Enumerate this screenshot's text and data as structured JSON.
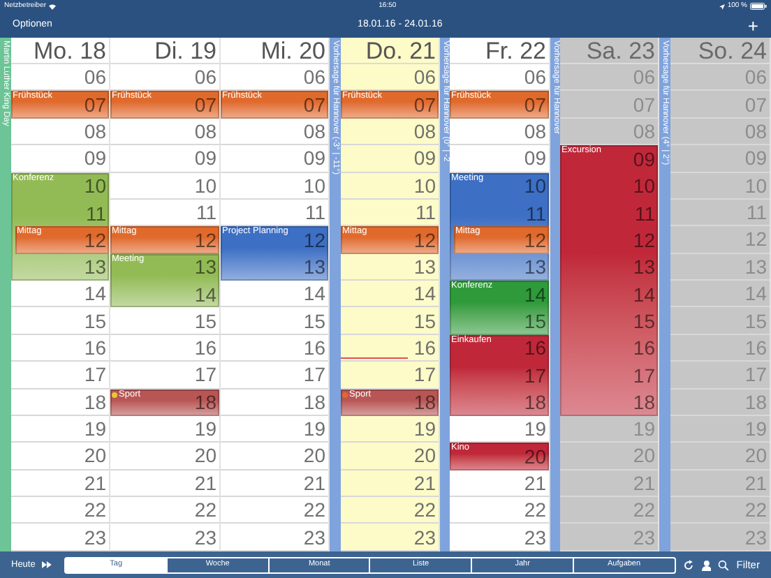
{
  "status_bar": {
    "carrier": "Netzbetreiber",
    "time": "16:50",
    "battery": "100 %"
  },
  "nav": {
    "left": "Optionen",
    "title": "18.01.16 - 24.01.16",
    "right": "+"
  },
  "columns": [
    {
      "kind": "strip",
      "label": "Martin Luther King Day",
      "color": "#6cc497"
    },
    {
      "kind": "day",
      "header": "Mo. 18",
      "today": false,
      "weekend": false,
      "rows": [
        {
          "kind": "hour",
          "label": "06"
        },
        {
          "kind": "event",
          "title": "Frühstück",
          "color": "#e06a2c",
          "rows": [
            {
              "kind": "hour",
              "label": "07"
            }
          ]
        },
        {
          "kind": "hour",
          "label": "08"
        },
        {
          "kind": "hour",
          "label": "09"
        },
        {
          "kind": "event",
          "title": "Konferenz",
          "color": "#93bb55",
          "rows": [
            {
              "kind": "hour",
              "label": "10"
            },
            {
              "kind": "hour",
              "label": "11"
            },
            {
              "kind": "event",
              "title": "Mittag",
              "color": "#e06a2c",
              "rows": [
                {
                  "kind": "hour",
                  "label": "12"
                }
              ]
            },
            {
              "kind": "hour",
              "label": "13"
            }
          ]
        },
        {
          "kind": "hour",
          "label": "14"
        },
        {
          "kind": "hour",
          "label": "15"
        },
        {
          "kind": "hour",
          "label": "16"
        },
        {
          "kind": "hour",
          "label": "17"
        },
        {
          "kind": "hour",
          "label": "18"
        },
        {
          "kind": "hour",
          "label": "19"
        },
        {
          "kind": "hour",
          "label": "20"
        },
        {
          "kind": "hour",
          "label": "21"
        },
        {
          "kind": "hour",
          "label": "22"
        },
        {
          "kind": "hour",
          "label": "23"
        }
      ]
    },
    {
      "kind": "day",
      "header": "Di. 19",
      "today": false,
      "weekend": false,
      "rows": [
        {
          "kind": "hour",
          "label": "06"
        },
        {
          "kind": "event",
          "title": "Frühstück",
          "color": "#e06a2c",
          "rows": [
            {
              "kind": "hour",
              "label": "07"
            }
          ]
        },
        {
          "kind": "hour",
          "label": "08"
        },
        {
          "kind": "hour",
          "label": "09"
        },
        {
          "kind": "hour",
          "label": "10"
        },
        {
          "kind": "hour",
          "label": "11"
        },
        {
          "kind": "event",
          "title": "Mittag",
          "color": "#e06a2c",
          "rows": [
            {
              "kind": "hour",
              "label": "12"
            }
          ]
        },
        {
          "kind": "event",
          "title": "Meeting",
          "color": "#93bb55",
          "rows": [
            {
              "kind": "hour",
              "label": "13"
            },
            {
              "kind": "hour",
              "label": "14"
            }
          ]
        },
        {
          "kind": "hour",
          "label": "15"
        },
        {
          "kind": "hour",
          "label": "16"
        },
        {
          "kind": "hour",
          "label": "17"
        },
        {
          "kind": "event",
          "title": "Sport",
          "color": "#b85555",
          "marker": {
            "color": "#e8c830"
          },
          "rows": [
            {
              "kind": "hour",
              "label": "18"
            }
          ]
        },
        {
          "kind": "hour",
          "label": "19"
        },
        {
          "kind": "hour",
          "label": "20"
        },
        {
          "kind": "hour",
          "label": "21"
        },
        {
          "kind": "hour",
          "label": "22"
        },
        {
          "kind": "hour",
          "label": "23"
        }
      ]
    },
    {
      "kind": "day",
      "header": "Mi. 20",
      "today": false,
      "weekend": false,
      "rows": [
        {
          "kind": "hour",
          "label": "06"
        },
        {
          "kind": "event",
          "title": "Frühstück",
          "color": "#e06a2c",
          "rows": [
            {
              "kind": "hour",
              "label": "07"
            }
          ]
        },
        {
          "kind": "hour",
          "label": "08"
        },
        {
          "kind": "hour",
          "label": "09"
        },
        {
          "kind": "hour",
          "label": "10"
        },
        {
          "kind": "hour",
          "label": "11"
        },
        {
          "kind": "event",
          "title": "Project Planning",
          "color": "#3d6fc4",
          "rows": [
            {
              "kind": "hour",
              "label": "12"
            },
            {
              "kind": "hour",
              "label": "13"
            }
          ]
        },
        {
          "kind": "hour",
          "label": "14"
        },
        {
          "kind": "hour",
          "label": "15"
        },
        {
          "kind": "hour",
          "label": "16"
        },
        {
          "kind": "hour",
          "label": "17"
        },
        {
          "kind": "hour",
          "label": "18"
        },
        {
          "kind": "hour",
          "label": "19"
        },
        {
          "kind": "hour",
          "label": "20"
        },
        {
          "kind": "hour",
          "label": "21"
        },
        {
          "kind": "hour",
          "label": "22"
        },
        {
          "kind": "hour",
          "label": "23"
        }
      ]
    },
    {
      "kind": "strip",
      "label": "Vorhersage für Hannover (-3° | -11°)",
      "color": "#7fa3dc"
    },
    {
      "kind": "day",
      "header": "Do. 21",
      "today": true,
      "weekend": false,
      "now": true,
      "rows": [
        {
          "kind": "hour",
          "label": "06"
        },
        {
          "kind": "event",
          "title": "Frühstück",
          "color": "#e06a2c",
          "rows": [
            {
              "kind": "hour",
              "label": "07"
            }
          ]
        },
        {
          "kind": "hour",
          "label": "08"
        },
        {
          "kind": "hour",
          "label": "09"
        },
        {
          "kind": "hour",
          "label": "10"
        },
        {
          "kind": "hour",
          "label": "11"
        },
        {
          "kind": "event",
          "title": "Mittag",
          "color": "#e06a2c",
          "rows": [
            {
              "kind": "hour",
              "label": "12"
            }
          ]
        },
        {
          "kind": "hour",
          "label": "13"
        },
        {
          "kind": "hour",
          "label": "14"
        },
        {
          "kind": "hour",
          "label": "15"
        },
        {
          "kind": "hour",
          "label": "16"
        },
        {
          "kind": "hour",
          "label": "17"
        },
        {
          "kind": "event",
          "title": "Sport",
          "color": "#b85555",
          "marker": {
            "color": "#e06a2c"
          },
          "rows": [
            {
              "kind": "hour",
              "label": "18"
            }
          ]
        },
        {
          "kind": "hour",
          "label": "19"
        },
        {
          "kind": "hour",
          "label": "20"
        },
        {
          "kind": "hour",
          "label": "21"
        },
        {
          "kind": "hour",
          "label": "22"
        },
        {
          "kind": "hour",
          "label": "23"
        }
      ]
    },
    {
      "kind": "strip",
      "label": "Vorhersage für Hannover (0° | -2",
      "color": "#7fa3dc"
    },
    {
      "kind": "day",
      "header": "Fr. 22",
      "today": false,
      "weekend": false,
      "rows": [
        {
          "kind": "hour",
          "label": "06"
        },
        {
          "kind": "event",
          "title": "Frühstück",
          "color": "#e06a2c",
          "rows": [
            {
              "kind": "hour",
              "label": "07"
            }
          ]
        },
        {
          "kind": "hour",
          "label": "08"
        },
        {
          "kind": "hour",
          "label": "09"
        },
        {
          "kind": "event",
          "title": "Meeting",
          "color": "#3d6fc4",
          "rows": [
            {
              "kind": "hour",
              "label": "10"
            },
            {
              "kind": "hour",
              "label": "11"
            },
            {
              "kind": "event",
              "title": "Mittag",
              "color": "#e06a2c",
              "rows": [
                {
                  "kind": "hour",
                  "label": "12"
                }
              ]
            },
            {
              "kind": "hour",
              "label": "13"
            }
          ]
        },
        {
          "kind": "event",
          "title": "Konferenz",
          "color": "#2f9a3a",
          "rows": [
            {
              "kind": "hour",
              "label": "14"
            },
            {
              "kind": "hour",
              "label": "15"
            }
          ]
        },
        {
          "kind": "event",
          "title": "Einkaufen",
          "color": "#c0283a",
          "rows": [
            {
              "kind": "hour",
              "label": "16"
            },
            {
              "kind": "hour",
              "label": "17"
            },
            {
              "kind": "hour",
              "label": "18"
            }
          ]
        },
        {
          "kind": "hour",
          "label": "19"
        },
        {
          "kind": "event",
          "title": "Kino",
          "color": "#c0283a",
          "rows": [
            {
              "kind": "hour",
              "label": "20"
            }
          ]
        },
        {
          "kind": "hour",
          "label": "21"
        },
        {
          "kind": "hour",
          "label": "22"
        },
        {
          "kind": "hour",
          "label": "23"
        }
      ]
    },
    {
      "kind": "strip",
      "label": "Vorhersage für Hannover",
      "color": "#7fa3dc"
    },
    {
      "kind": "day",
      "header": "Sa. 23",
      "today": false,
      "weekend": true,
      "rows": [
        {
          "kind": "hour",
          "label": "06"
        },
        {
          "kind": "hour",
          "label": "07"
        },
        {
          "kind": "hour",
          "label": "08"
        },
        {
          "kind": "event",
          "title": "Excursion",
          "color": "#c0283a",
          "rows": [
            {
              "kind": "hour",
              "label": "09"
            },
            {
              "kind": "hour",
              "label": "10"
            },
            {
              "kind": "hour",
              "label": "11"
            },
            {
              "kind": "hour",
              "label": "12"
            },
            {
              "kind": "hour",
              "label": "13"
            },
            {
              "kind": "hour",
              "label": "14"
            },
            {
              "kind": "hour",
              "label": "15"
            },
            {
              "kind": "hour",
              "label": "16"
            },
            {
              "kind": "hour",
              "label": "17"
            },
            {
              "kind": "hour",
              "label": "18"
            }
          ]
        },
        {
          "kind": "hour",
          "label": "19"
        },
        {
          "kind": "hour",
          "label": "20"
        },
        {
          "kind": "hour",
          "label": "21"
        },
        {
          "kind": "hour",
          "label": "22"
        },
        {
          "kind": "hour",
          "label": "23"
        }
      ]
    },
    {
      "kind": "strip",
      "label": "Vorhersage für Hannover (4° | 2°)",
      "color": "#7fa3dc"
    },
    {
      "kind": "day",
      "header": "So. 24",
      "today": false,
      "weekend": true,
      "rows": [
        {
          "kind": "hour",
          "label": "06"
        },
        {
          "kind": "hour",
          "label": "07"
        },
        {
          "kind": "hour",
          "label": "08"
        },
        {
          "kind": "hour",
          "label": "09"
        },
        {
          "kind": "hour",
          "label": "10"
        },
        {
          "kind": "hour",
          "label": "11"
        },
        {
          "kind": "hour",
          "label": "12"
        },
        {
          "kind": "hour",
          "label": "13"
        },
        {
          "kind": "hour",
          "label": "14"
        },
        {
          "kind": "hour",
          "label": "15"
        },
        {
          "kind": "hour",
          "label": "16"
        },
        {
          "kind": "hour",
          "label": "17"
        },
        {
          "kind": "hour",
          "label": "18"
        },
        {
          "kind": "hour",
          "label": "19"
        },
        {
          "kind": "hour",
          "label": "20"
        },
        {
          "kind": "hour",
          "label": "21"
        },
        {
          "kind": "hour",
          "label": "22"
        },
        {
          "kind": "hour",
          "label": "23"
        }
      ]
    }
  ],
  "toolbar": {
    "today": "Heute",
    "filter": "Filter",
    "tabs": [
      {
        "label": "Tag",
        "selected": true
      },
      {
        "label": "Woche",
        "selected": false
      },
      {
        "label": "Monat",
        "selected": false
      },
      {
        "label": "Liste",
        "selected": false
      },
      {
        "label": "Jahr",
        "selected": false
      },
      {
        "label": "Aufgaben",
        "selected": false
      }
    ]
  }
}
